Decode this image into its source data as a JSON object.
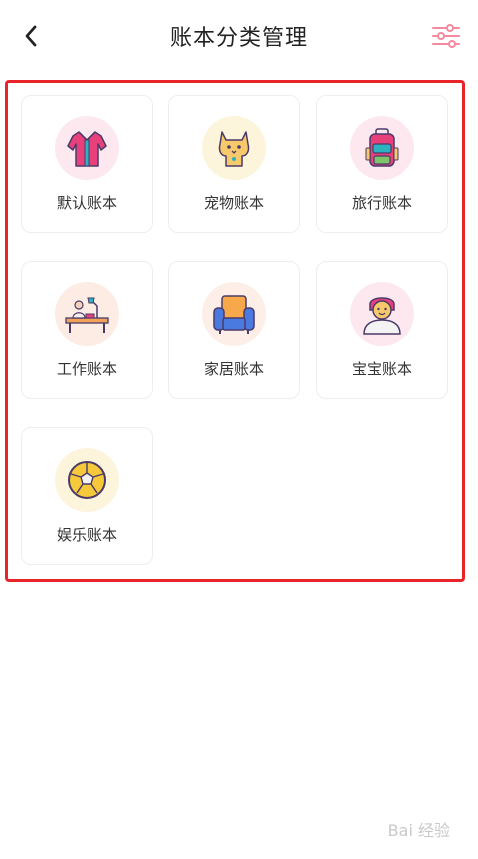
{
  "header": {
    "title": "账本分类管理",
    "back_icon": "chevron-left-icon",
    "settings_icon": "sliders-icon",
    "accent_color": "#f48a9e"
  },
  "frame_color": "#e8232a",
  "books": [
    {
      "label": "默认账本",
      "icon": "shirt-icon",
      "bg": "#fde8ef"
    },
    {
      "label": "宠物账本",
      "icon": "cat-icon",
      "bg": "#fdf4dc"
    },
    {
      "label": "旅行账本",
      "icon": "backpack-icon",
      "bg": "#fde8ef"
    },
    {
      "label": "工作账本",
      "icon": "desk-icon",
      "bg": "#fdece4"
    },
    {
      "label": "家居账本",
      "icon": "armchair-icon",
      "bg": "#fdeee8"
    },
    {
      "label": "宝宝账本",
      "icon": "baby-icon",
      "bg": "#fde8ef"
    },
    {
      "label": "娱乐账本",
      "icon": "football-icon",
      "bg": "#fdf4dc"
    }
  ],
  "watermark": "Bai 经验"
}
